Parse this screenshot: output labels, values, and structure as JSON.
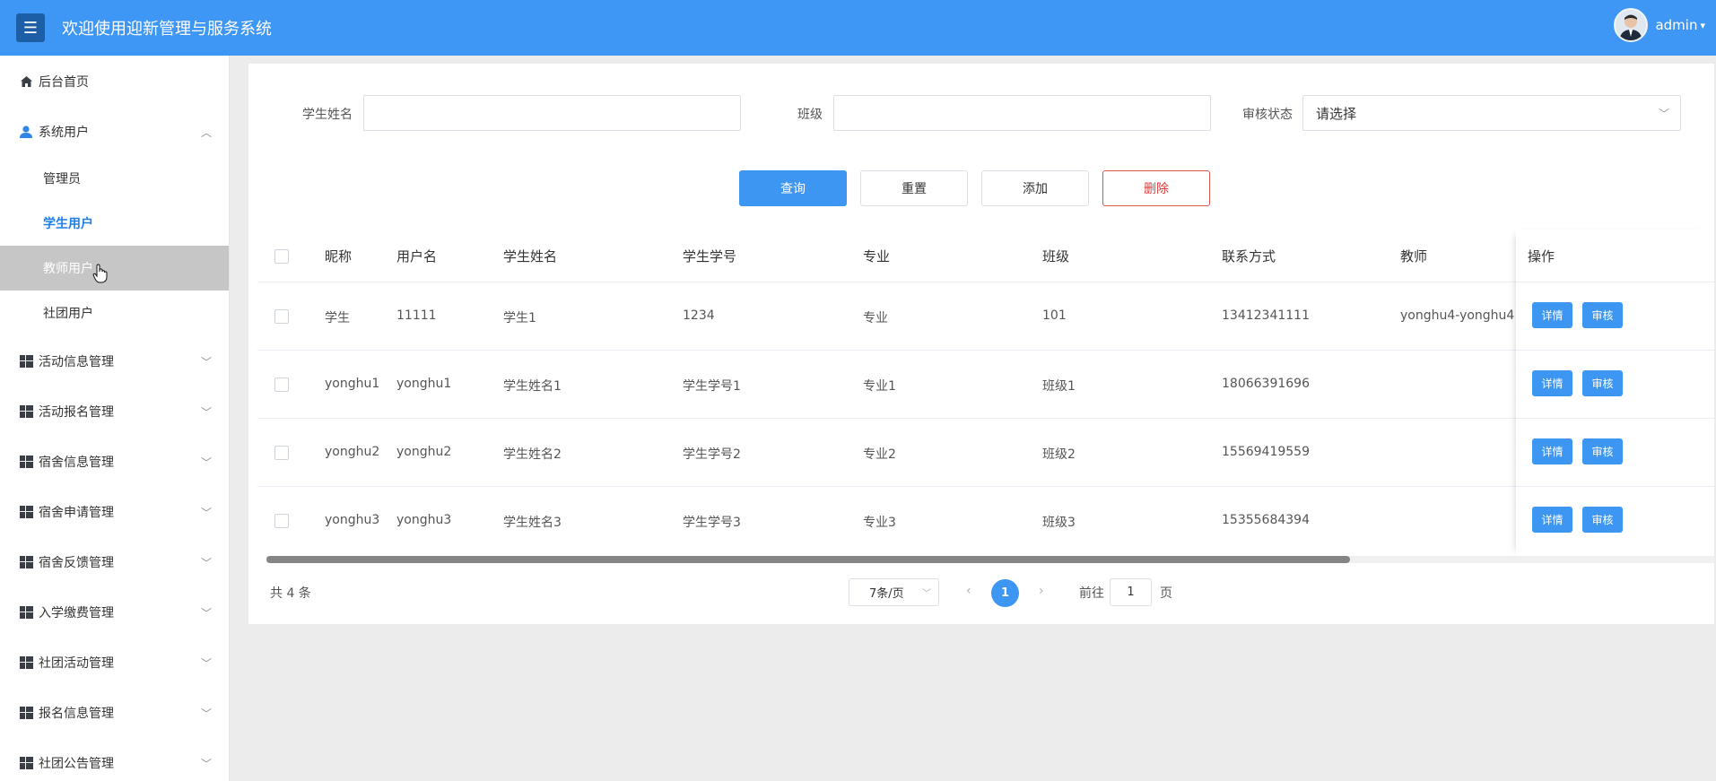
{
  "header": {
    "title": "欢迎使用迎新管理与服务系统",
    "username": "admin"
  },
  "sidebar": {
    "home": "后台首页",
    "system_users": "系统用户",
    "sub_items": [
      "管理员",
      "学生用户",
      "教师用户",
      "社团用户"
    ],
    "groups": [
      "活动信息管理",
      "活动报名管理",
      "宿舍信息管理",
      "宿舍申请管理",
      "宿舍反馈管理",
      "入学缴费管理",
      "社团活动管理",
      "报名信息管理",
      "社团公告管理"
    ]
  },
  "filters": {
    "student_name_label": "学生姓名",
    "class_label": "班级",
    "status_label": "审核状态",
    "status_value": "请选择"
  },
  "actions": {
    "query": "查询",
    "reset": "重置",
    "add": "添加",
    "delete": "删除"
  },
  "table": {
    "headers": [
      "昵称",
      "用户名",
      "学生姓名",
      "学生学号",
      "专业",
      "班级",
      "联系方式",
      "教师",
      "操作"
    ],
    "rows": [
      [
        "学生",
        "11111",
        "学生1",
        "1234",
        "专业",
        "101",
        "13412341111",
        "yonghu4-yonghu4"
      ],
      [
        "yonghu1",
        "yonghu1",
        "学生姓名1",
        "学生学号1",
        "专业1",
        "班级1",
        "18066391696",
        ""
      ],
      [
        "yonghu2",
        "yonghu2",
        "学生姓名2",
        "学生学号2",
        "专业2",
        "班级2",
        "15569419559",
        ""
      ],
      [
        "yonghu3",
        "yonghu3",
        "学生姓名3",
        "学生学号3",
        "专业3",
        "班级3",
        "15355684394",
        ""
      ]
    ],
    "detail_label": "详情",
    "audit_label": "审核"
  },
  "pagination": {
    "total": "共 4 条",
    "page_size": "7条/页",
    "current_page": "1",
    "goto_prefix": "前往",
    "goto_value": "1",
    "goto_suffix": "页"
  }
}
